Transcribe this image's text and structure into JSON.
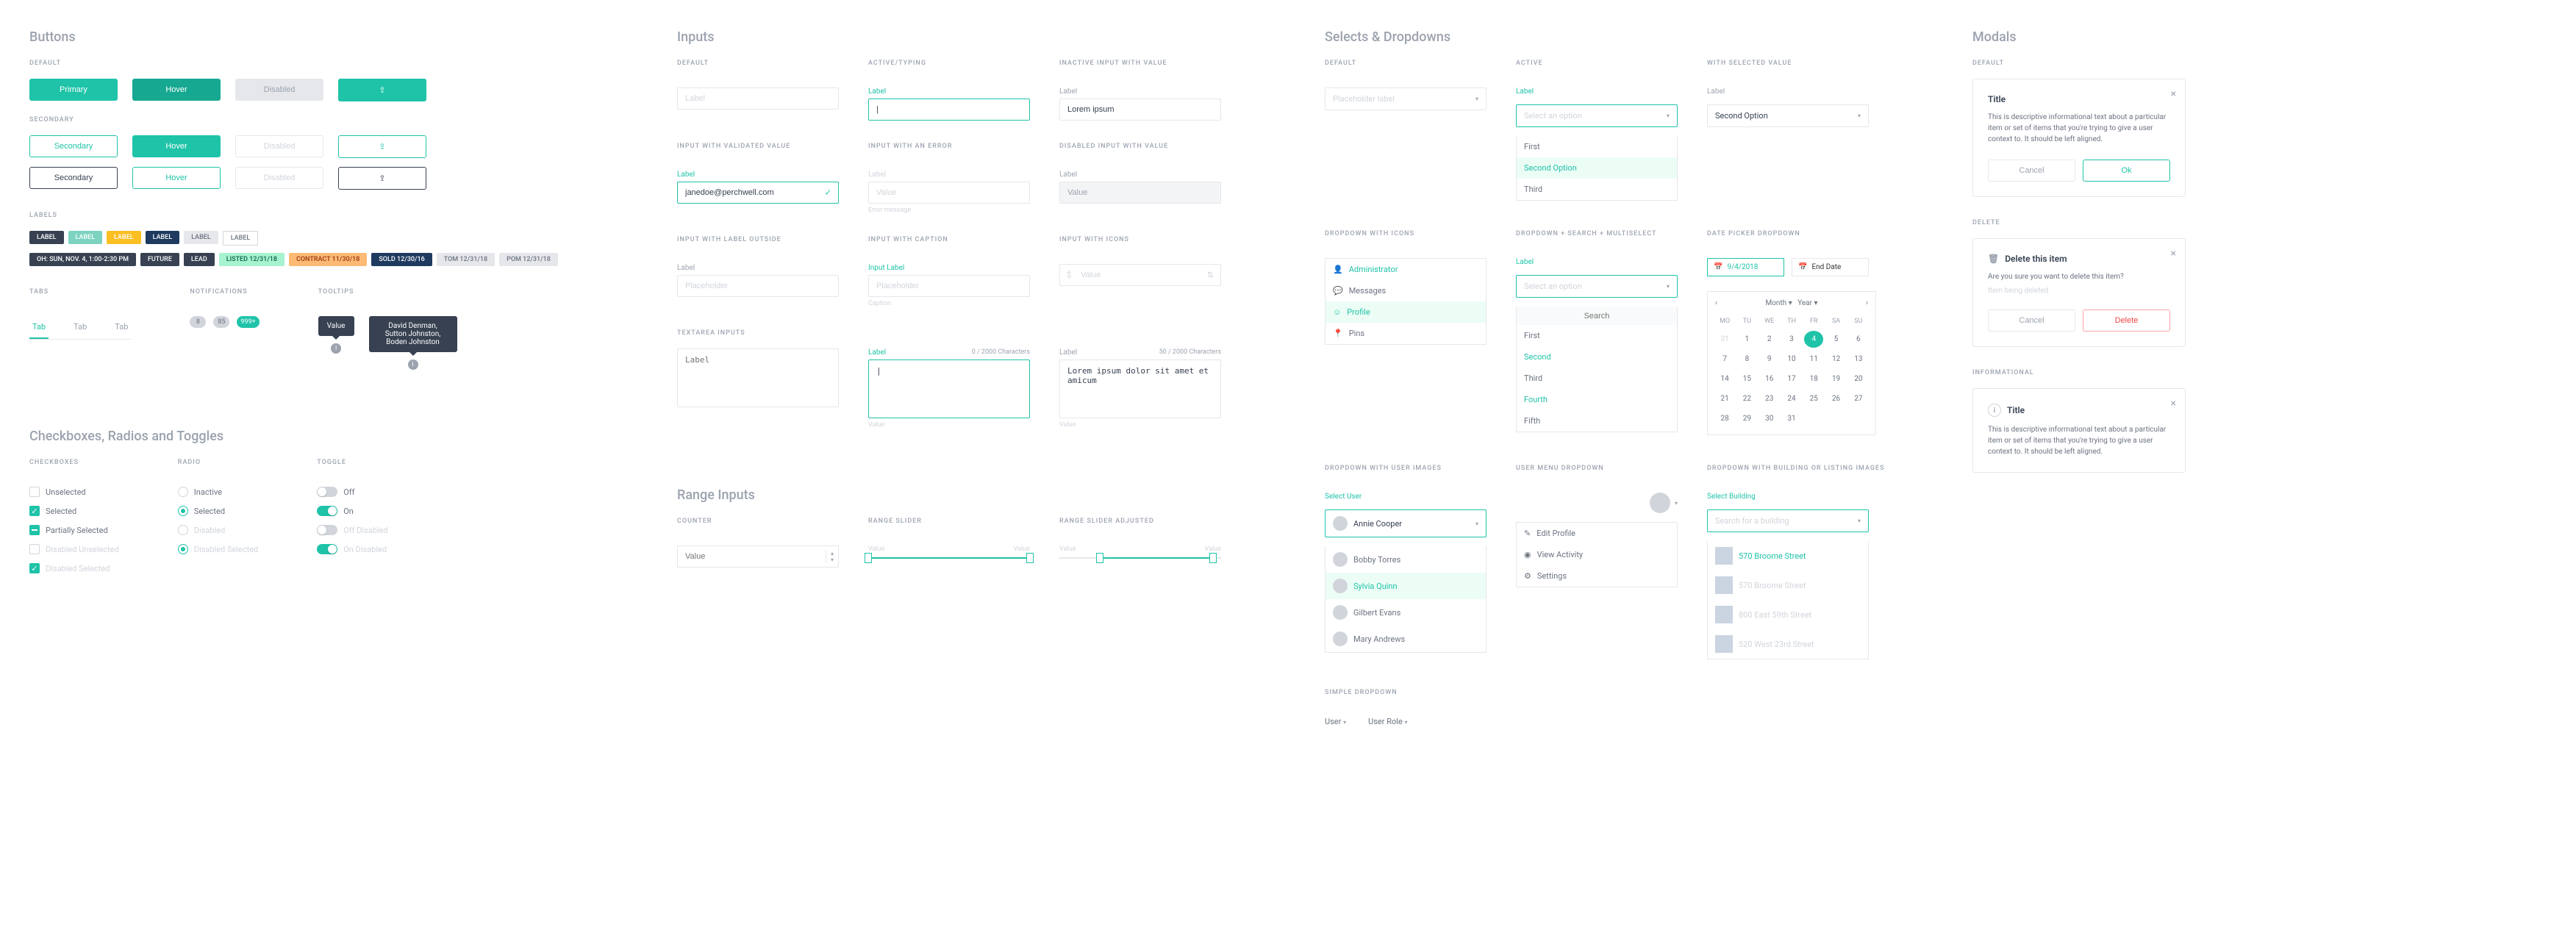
{
  "buttons": {
    "heading": "Buttons",
    "default_label": "DEFAULT",
    "secondary_label": "SECONDARY",
    "primary": {
      "default": "Primary",
      "hover": "Hover",
      "disabled": "Disabled"
    },
    "secondary": {
      "default": "Secondary",
      "hover": "Hover",
      "disabled": "Disabled"
    },
    "tertiary": {
      "default": "Secondary",
      "hover": "Hover",
      "disabled": "Disabled"
    },
    "icon_glyph": "⇪"
  },
  "labels": {
    "heading": "LABELS",
    "row1": [
      "LABEL",
      "LABEL",
      "LABEL",
      "LABEL",
      "LABEL",
      "LABEL"
    ],
    "row2": [
      "OH: SUN, NOV. 4, 1:00-2:30 PM",
      "FUTURE",
      "LEAD",
      "LISTED 12/31/18",
      "CONTRACT 11/30/18",
      "SOLD 12/30/16",
      "TOM 12/31/18",
      "POM 12/31/18"
    ]
  },
  "tabs": {
    "heading": "TABS",
    "items": [
      "Tab",
      "Tab",
      "Tab"
    ]
  },
  "notifications": {
    "heading": "NOTIFICATIONS",
    "items": [
      "8",
      "85",
      "999+"
    ]
  },
  "tooltips": {
    "heading": "TOOLTIPS",
    "value": "Value",
    "names": "David Denman, Sutton Johnston, Boden Johnston",
    "info": "i"
  },
  "checkboxes": {
    "heading": "Checkboxes, Radios and Toggles",
    "cb_label": "CHECKBOXES",
    "radio_label": "RADIO",
    "toggle_label": "TOGGLE",
    "cb": [
      "Unselected",
      "Selected",
      "Partially Selected",
      "Disabled Unselected",
      "Disabled Selected"
    ],
    "radio": [
      "Inactive",
      "Selected",
      "Disabled",
      "Disabled Selected"
    ],
    "toggle": [
      "Off",
      "On",
      "Off Disabled",
      "On Disabled"
    ]
  },
  "inputs": {
    "heading": "Inputs",
    "default": "DEFAULT",
    "active": "ACTIVE/TYPING",
    "inactive_val": "INACTIVE INPUT WITH VALUE",
    "validated": "INPUT WITH VALIDATED VALUE",
    "error": "INPUT WITH AN ERROR",
    "disabled": "DISABLED INPUT WITH VALUE",
    "outside": "INPUT WITH LABEL OUTSIDE",
    "caption": "INPUT WITH CAPTION",
    "icons": "INPUT WITH ICONS",
    "textarea": "TEXTAREA INPUTS",
    "label": "Label",
    "input_label": "Input Label",
    "value": "Value",
    "placeholder": "Placeholder",
    "lorem": "Lorem ipsum",
    "email": "janedoe@perchwell.com",
    "error_msg": "Error message",
    "caption_text": "Caption",
    "char0": "0 / 2000 Characters",
    "char50": "50 / 2000 Characters",
    "lorem_long": "Lorem ipsum dolor sit amet et amicum"
  },
  "range": {
    "heading": "Range Inputs",
    "counter": "COUNTER",
    "slider": "RANGE SLIDER",
    "adjusted": "RANGE SLIDER ADJUSTED",
    "value": "Value"
  },
  "selects": {
    "heading": "Selects & Dropdowns",
    "default": "DEFAULT",
    "active": "ACTIVE",
    "selected_val": "WITH SELECTED VALUE",
    "placeholder_label": "Placeholder label",
    "label": "Label",
    "select_option": "Select an option",
    "second_option": "Second Option",
    "options": [
      "First",
      "Second Option",
      "Third"
    ],
    "icons_label": "DROPDOWN WITH ICONS",
    "icon_items": [
      "Administrator",
      "Messages",
      "Profile",
      "Pins"
    ],
    "search_label": "DROPDOWN + SEARCH + MULTISELECT",
    "search_placeholder": "Search",
    "search_options": [
      "First",
      "Second",
      "Third",
      "Fourth",
      "Fifth"
    ],
    "user_images_label": "DROPDOWN WITH USER IMAGES",
    "select_user": "Select User",
    "users": [
      "Annie Cooper",
      "Bobby Torres",
      "Sylvia Quinn",
      "Gilbert Evans",
      "Mary Andrews"
    ],
    "user_menu_label": "USER MENU DROPDOWN",
    "user_menu": [
      "Edit Profile",
      "View Activity",
      "Settings"
    ],
    "simple_label": "SIMPLE DROPDOWN",
    "simple_user": "User",
    "simple_role": "User Role",
    "date_label": "DATE PICKER DROPDOWN",
    "start_date": "9/4/2018",
    "end_date": "End Date",
    "month": "Month",
    "year": "Year",
    "days": [
      "MO",
      "TU",
      "WE",
      "TH",
      "FR",
      "SA",
      "SU"
    ],
    "building_label": "DROPDOWN WITH BUILDING OR LISTING IMAGES",
    "select_building": "Select Building",
    "building_search": "Search for a building",
    "buildings": [
      "570 Broome Street",
      "570 Broome Street",
      "800 East 59th Street",
      "520 West 23rd Street"
    ]
  },
  "modals": {
    "heading": "Modals",
    "default": "DEFAULT",
    "delete_label": "DELETE",
    "info_label": "INFORMATIONAL",
    "title": "Title",
    "body": "This is descriptive informational text about a particular item or set of items that you're trying to give a user context to. It should be left aligned.",
    "cancel": "Cancel",
    "ok": "Ok",
    "delete_title": "Delete this item",
    "delete_body": "Are you sure you want to delete this item?",
    "delete_sub": "Item being deleted",
    "delete": "Delete"
  }
}
